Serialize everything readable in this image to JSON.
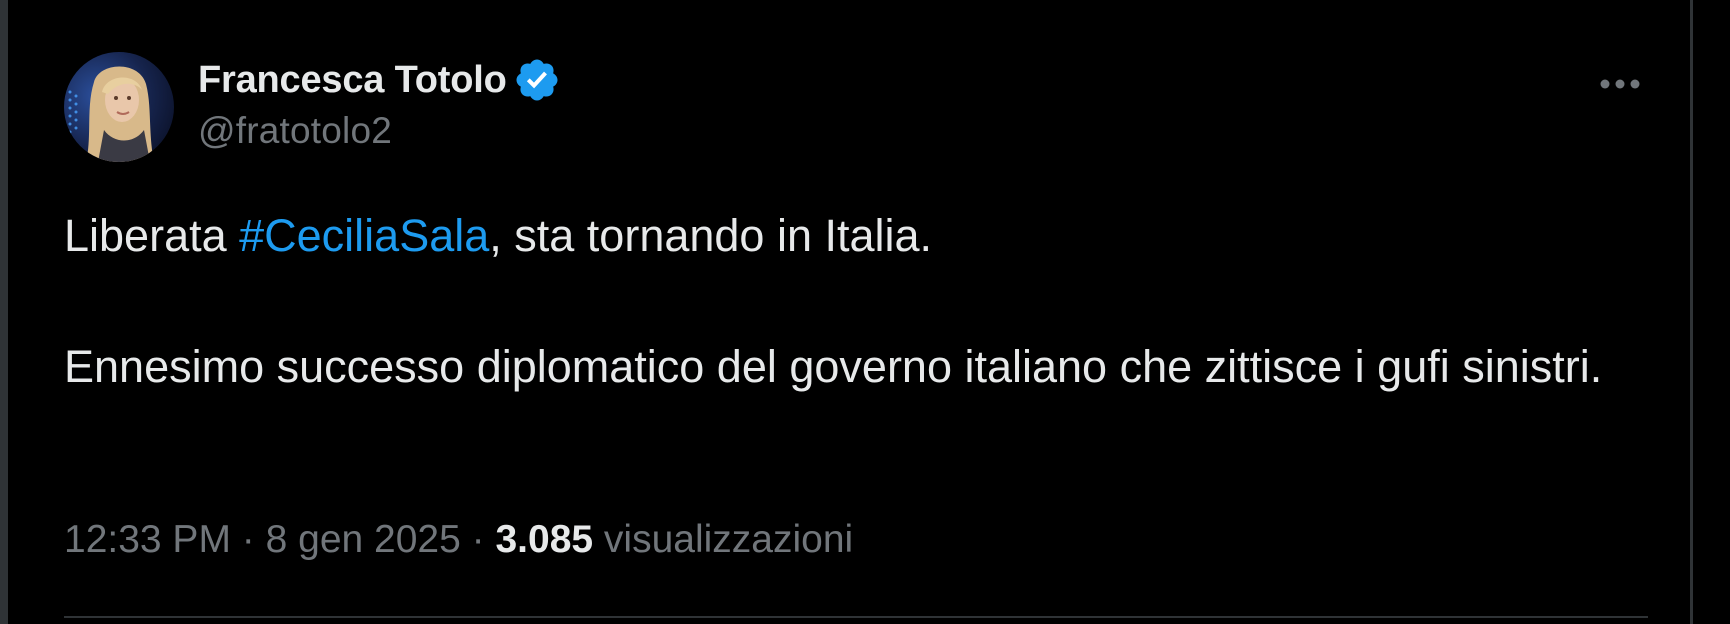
{
  "tweet": {
    "author": {
      "display_name": "Francesca Totolo",
      "handle": "@fratotolo2",
      "verified_icon": "verified-badge-icon",
      "verified_color": "#1d9bf0"
    },
    "more_icon": "more-horizontal-icon",
    "text": {
      "line1_prefix": "Liberata ",
      "hashtag": "#CeciliaSala",
      "line1_suffix": ", sta tornando in Italia.",
      "paragraph2": "Ennesimo successo diplomatico del governo italiano che zittisce i gufi sinistri."
    },
    "meta": {
      "time": "12:33 PM",
      "separator": " · ",
      "date": "8 gen 2025",
      "views_count": "3.085",
      "views_label": " visualizzazioni"
    }
  },
  "colors": {
    "background": "#000000",
    "text": "#e7e9ea",
    "secondary": "#71767b",
    "accent": "#1d9bf0",
    "border": "#2f3336"
  }
}
